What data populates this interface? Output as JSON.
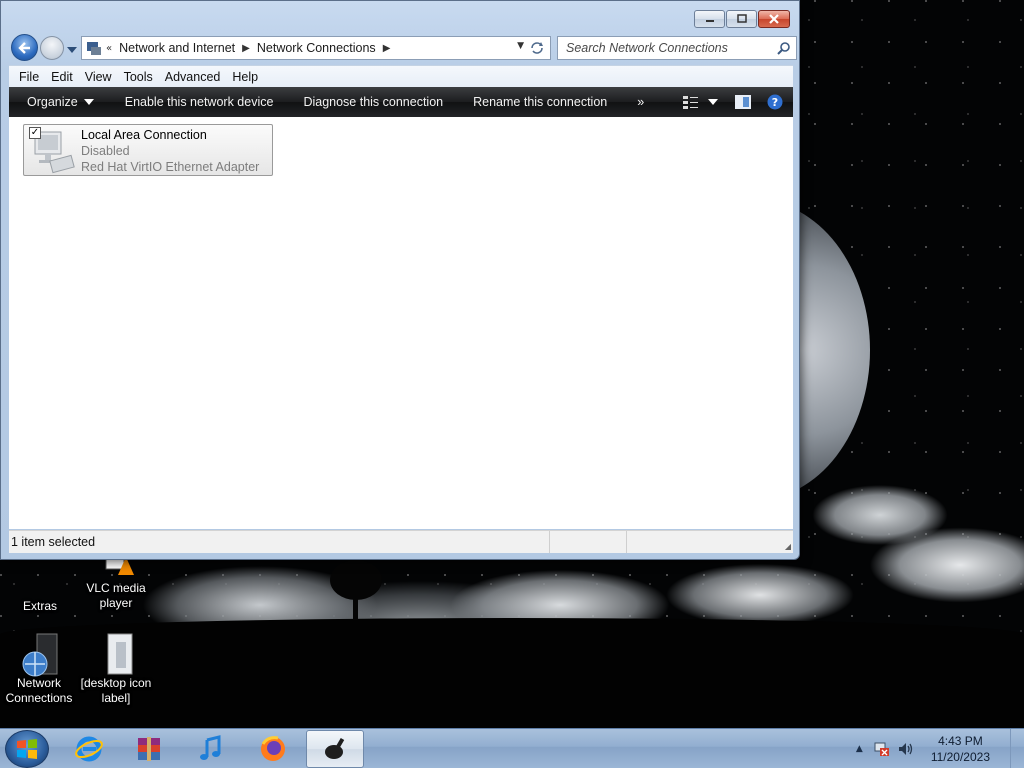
{
  "window": {
    "address_segments": [
      "Network and Internet",
      "Network Connections"
    ],
    "search_placeholder": "Search Network Connections"
  },
  "menubar": [
    "File",
    "Edit",
    "View",
    "Tools",
    "Advanced",
    "Help"
  ],
  "commandbar": {
    "organize": "Organize",
    "enable": "Enable this network device",
    "diagnose": "Diagnose this connection",
    "rename": "Rename this connection",
    "more": "»"
  },
  "connection": {
    "name": "Local Area Connection",
    "status": "Disabled",
    "adapter": "Red Hat VirtIO Ethernet Adapter",
    "checked": "✓"
  },
  "statusbar": {
    "text": "1 item selected"
  },
  "desktop_icons": [
    {
      "label": "Extras",
      "icon": "folder-icon"
    },
    {
      "label": "VLC media player",
      "icon": "vlc-icon"
    },
    {
      "label": "Network Connections",
      "icon": "network-icon"
    },
    {
      "label": "[desktop icon label]",
      "icon": "document-icon"
    }
  ],
  "taskbar": {
    "pinned": [
      "ie-icon",
      "winrar-icon",
      "itunes-icon",
      "firefox-icon",
      "network-app-icon"
    ],
    "clock": {
      "time": "4:43 PM",
      "date": "11/20/2023"
    }
  },
  "colors": {
    "command_bar": "#1c1d1f",
    "window_frame": "#b8cde6",
    "taskbar": "#92aed0",
    "close_button": "#c7452c"
  }
}
